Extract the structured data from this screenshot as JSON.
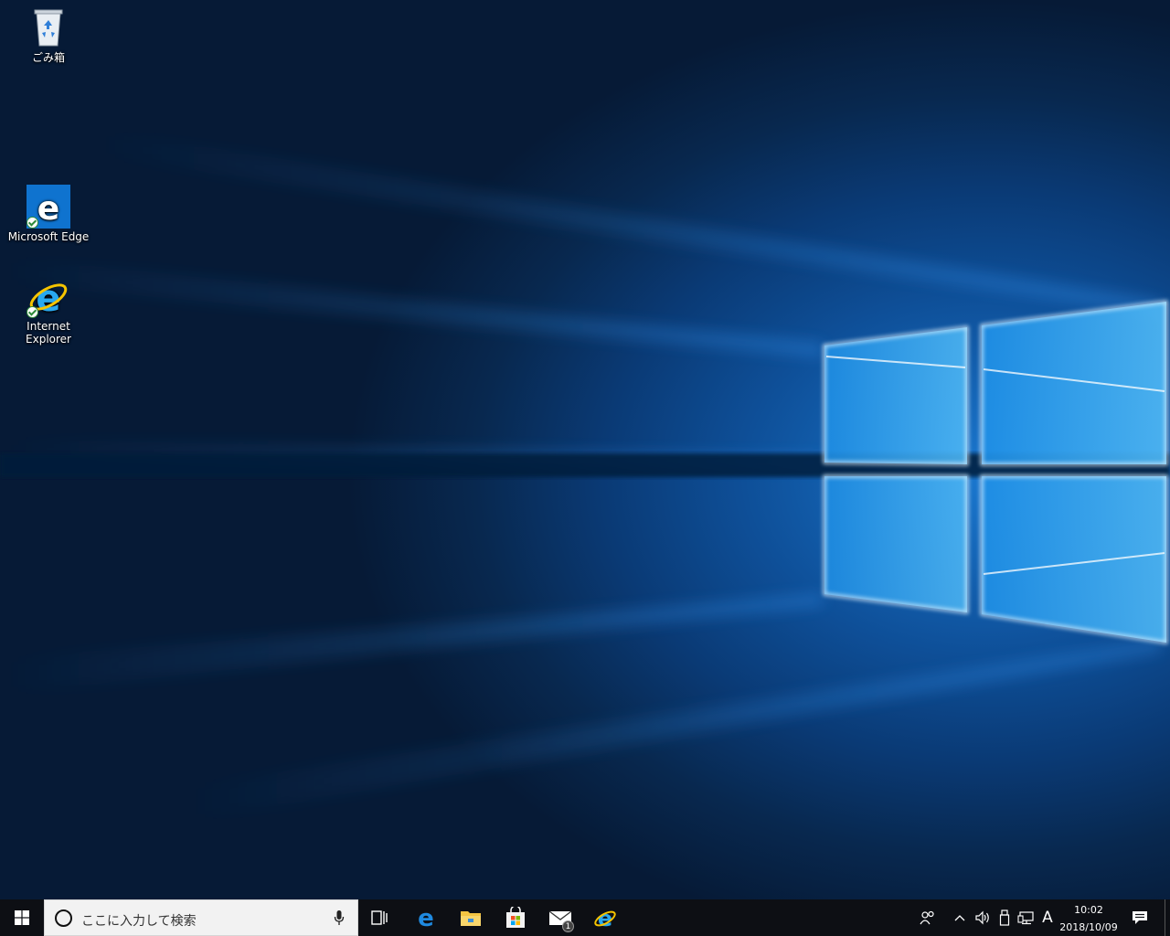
{
  "desktop": {
    "icons": [
      {
        "label": "ごみ箱",
        "icon": "recycle-bin-icon"
      },
      {
        "label": "Microsoft Edge",
        "icon": "edge-icon"
      },
      {
        "label": "Internet Explorer",
        "icon": "ie-icon"
      }
    ]
  },
  "taskbar": {
    "search_placeholder": "ここに入力して検索",
    "apps": [
      "task-view-icon",
      "edge-icon",
      "file-explorer-icon",
      "store-icon",
      "mail-icon",
      "ie-icon"
    ],
    "mail_badge": "1",
    "tray": {
      "ime_label": "A",
      "time": "10:02",
      "date": "2018/10/09"
    }
  },
  "colors": {
    "accent": "#0078d7",
    "taskbar_bg": "#0d0f14",
    "desktop_dark": "#061a36"
  }
}
